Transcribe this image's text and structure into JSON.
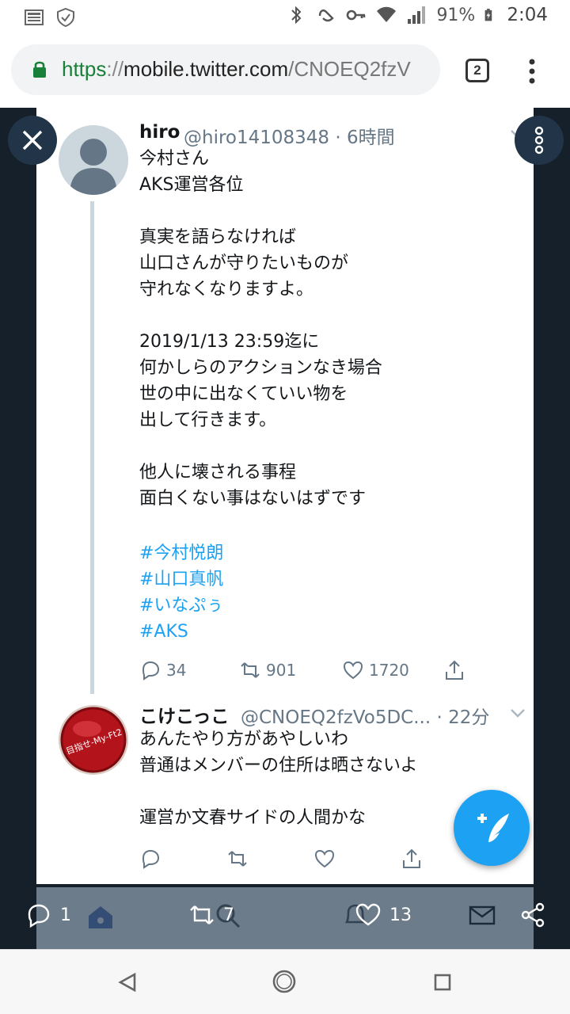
{
  "status_bar": {
    "battery": "91%",
    "time": "2:04"
  },
  "browser": {
    "url_scheme": "https",
    "url_sep": "://",
    "url_host": "mobile.twitter.com",
    "url_path": "/CNOEQ2fzV",
    "tab_count": "2"
  },
  "tweet_main": {
    "name": "hiro",
    "handle": "@hiro14108348 · 6時間",
    "text": "今村さん\nAKS運営各位\n\n真実を語らなければ\n山口さんが守りたいものが\n守れなくなりますよ。\n\n2019/1/13 23:59迄に\n何かしらのアクションなき場合\n世の中に出なくていい物を\n出して行きます。\n\n他人に壊される事程\n面白くない事はないはずです",
    "hashtags": [
      "#今村悦朗",
      "#山口真帆",
      "#いなぷぅ",
      "#AKS"
    ],
    "replies": "34",
    "retweets": "901",
    "likes": "1720"
  },
  "tweet_reply": {
    "name": "こけこっこ",
    "handle": "@CNOEQ2fzVo5DC... · 22分",
    "text": "あんたやり方があやしいわ\n普通はメンバーの住所は晒さないよ\n\n運営か文春サイドの人間かな",
    "avatar_label": "目指せ-My-Ft2"
  },
  "bottom_bar": {
    "replies": "1",
    "retweets": "7",
    "likes": "13"
  },
  "colors": {
    "accent": "#1da1f2",
    "overlay": "#15202b",
    "secure": "#188038"
  }
}
